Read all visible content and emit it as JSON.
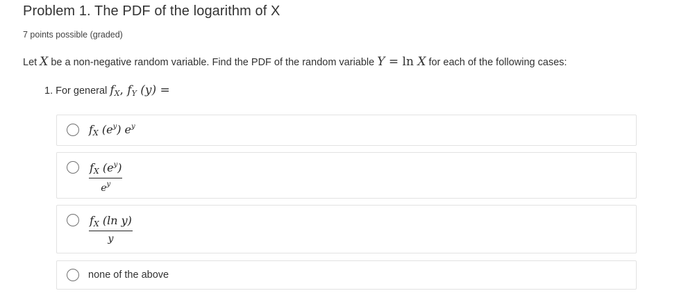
{
  "problem": {
    "title": "Problem 1. The PDF of the logarithm of X",
    "points": "7 points possible (graded)"
  },
  "prompt": {
    "text_1": "Let ",
    "var_X": "X",
    "text_2": " be a non-negative random variable. Find the PDF of the random variable ",
    "var_Y": "Y",
    "eq": " = ln ",
    "var_X2": "X",
    "text_3": " for each of the following cases:"
  },
  "question": {
    "number": "1. For general ",
    "f": "f",
    "fx_sub": "X",
    "comma": ", ",
    "f2": "f",
    "fy_sub": "Y",
    "arg": " (y) ="
  },
  "choices": [
    {
      "f": "f",
      "sub": "X",
      "open": " (e",
      "sup": "y",
      "close": ") e",
      "sup2": "y"
    },
    {
      "num_f": "f",
      "num_sub": "X",
      "num_open": " (e",
      "num_sup": "y",
      "num_close": ")",
      "den_e": "e",
      "den_sup": "y"
    },
    {
      "num_f": "f",
      "num_sub": "X",
      "num_rest": " (ln y)",
      "den": "y"
    },
    {
      "label": "none of the above"
    }
  ]
}
